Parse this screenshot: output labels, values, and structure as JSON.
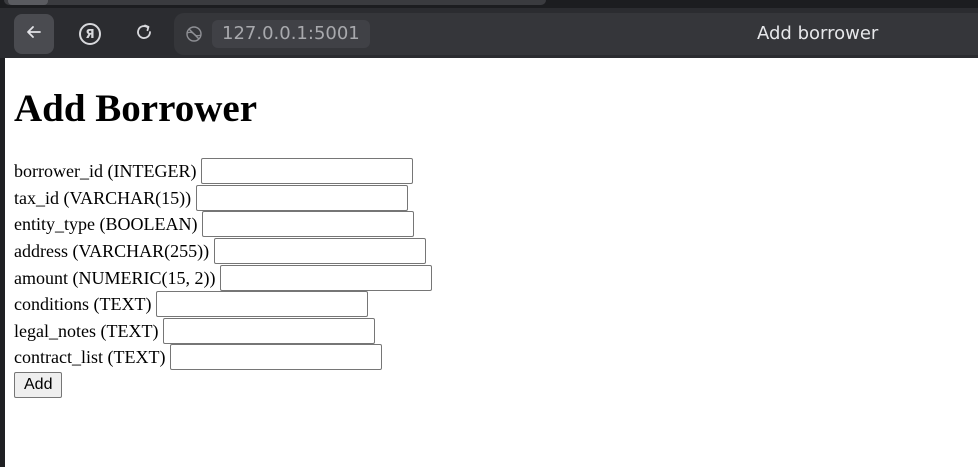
{
  "browser": {
    "url": "127.0.0.1:5001",
    "tab_title": "Add borrower",
    "yandex_glyph": "Я",
    "icons": {
      "back": "back-arrow-icon",
      "yandex": "yandex-icon",
      "reload": "reload-icon",
      "site": "globe-icon"
    }
  },
  "page": {
    "heading": "Add Borrower",
    "fields": [
      {
        "label": "borrower_id (INTEGER)",
        "value": ""
      },
      {
        "label": "tax_id (VARCHAR(15))",
        "value": ""
      },
      {
        "label": "entity_type (BOOLEAN)",
        "value": ""
      },
      {
        "label": "address (VARCHAR(255))",
        "value": ""
      },
      {
        "label": "amount (NUMERIC(15, 2))",
        "value": ""
      },
      {
        "label": "conditions (TEXT)",
        "value": ""
      },
      {
        "label": "legal_notes (TEXT)",
        "value": ""
      },
      {
        "label": "contract_list (TEXT)",
        "value": ""
      }
    ],
    "submit_label": "Add"
  }
}
